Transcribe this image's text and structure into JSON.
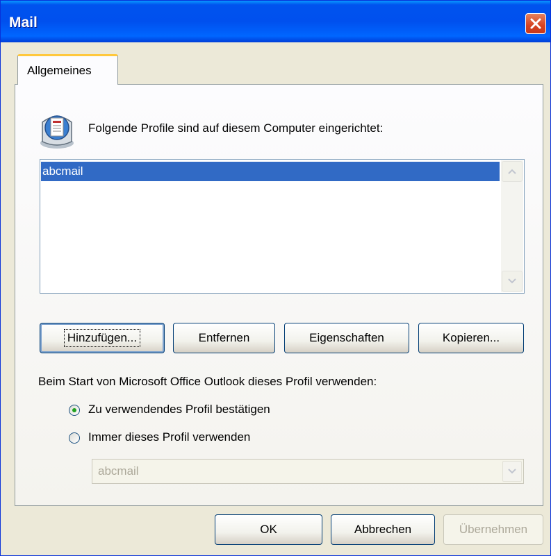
{
  "window": {
    "title": "Mail"
  },
  "tabs": [
    {
      "label": "Allgemeines",
      "active": true
    }
  ],
  "profiles": {
    "header": "Folgende Profile sind auf diesem Computer eingerichtet:",
    "items": [
      {
        "label": "abcmail",
        "selected": true
      }
    ]
  },
  "buttons": {
    "add": "Hinzufügen...",
    "remove": "Entfernen",
    "properties": "Eigenschaften",
    "copy": "Kopieren..."
  },
  "startup": {
    "label": "Beim Start von Microsoft Office Outlook dieses Profil verwenden:",
    "option_confirm": "Zu verwendendes Profil bestätigen",
    "option_always": "Immer dieses Profil verwenden",
    "selected_option": "confirm",
    "profile_select_value": "abcmail"
  },
  "footer": {
    "ok": "OK",
    "cancel": "Abbrechen",
    "apply": "Übernehmen"
  },
  "colors": {
    "titlebar": "#0054e3",
    "selection": "#316ac5",
    "dialog_bg": "#ece9d8",
    "tab_accent": "#ffc83c"
  },
  "icons": [
    "close-icon",
    "mail-profiles-icon",
    "scroll-up-icon",
    "scroll-down-icon",
    "dropdown-arrow-icon"
  ]
}
